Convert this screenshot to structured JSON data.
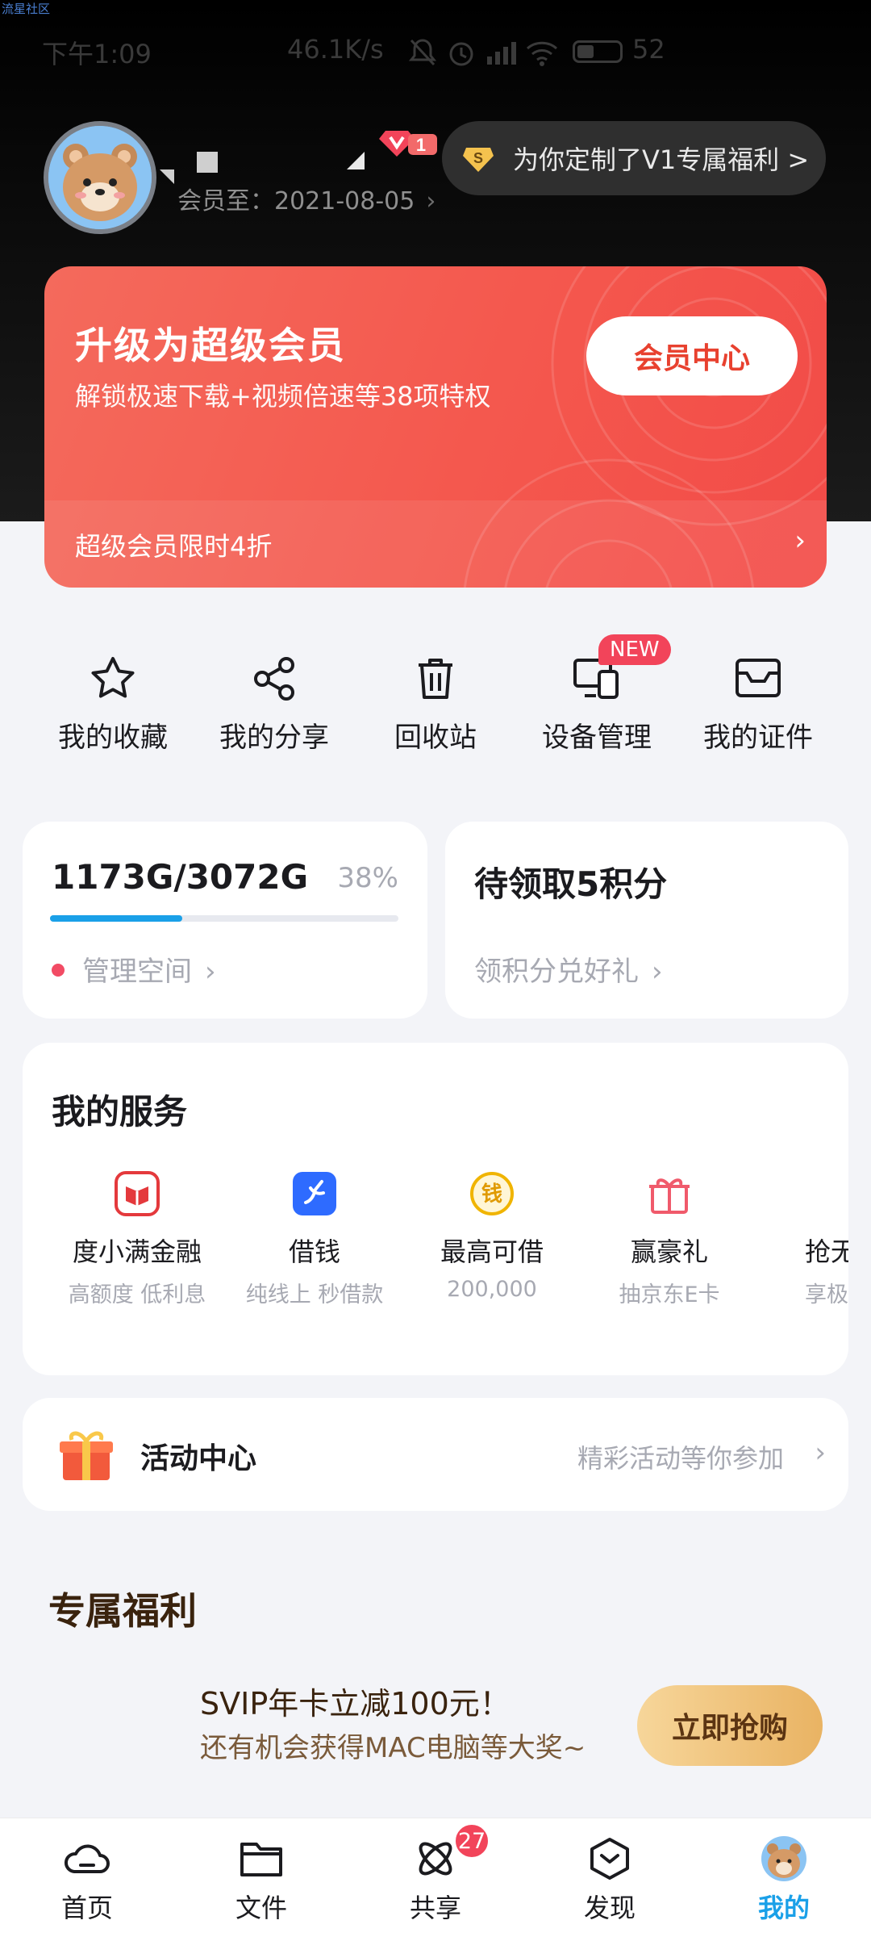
{
  "watermark": "流星社区",
  "status": {
    "time": "下午1:09",
    "net_speed": "46.1K/s",
    "battery": "52"
  },
  "profile": {
    "member_until": "会员至：2021-08-05",
    "vip_level": "1"
  },
  "promo": {
    "label": "为你定制了V1专属福利 >"
  },
  "vip_card": {
    "title": "升级为超级会员",
    "subtitle": "解锁极速下载+视频倍速等38项特权",
    "button": "会员中心",
    "bar_text": "超级会员限时4折"
  },
  "quick_actions": [
    {
      "label": "我的收藏",
      "icon": "star-icon"
    },
    {
      "label": "我的分享",
      "icon": "share-icon"
    },
    {
      "label": "回收站",
      "icon": "trash-icon"
    },
    {
      "label": "设备管理",
      "icon": "devices-icon"
    },
    {
      "label": "我的证件",
      "icon": "id-card-icon"
    }
  ],
  "new_tag": "NEW",
  "storage": {
    "value": "1173G/3072G",
    "percent": "38%",
    "used_fraction": 0.38,
    "manage": "管理空间"
  },
  "points": {
    "title": "待领取5积分",
    "link": "领积分兑好礼"
  },
  "services": {
    "title": "我的服务",
    "items": [
      {
        "name": "度小满金融",
        "desc": "高额度 低利息"
      },
      {
        "name": "借钱",
        "desc": "纯线上  秒借款"
      },
      {
        "name": "最高可借",
        "desc": "200,000"
      },
      {
        "name": "赢豪礼",
        "desc": "抽京东E卡"
      },
      {
        "name": "抢无限",
        "desc": "享极速"
      }
    ],
    "loan_icon_char": "钱"
  },
  "activity": {
    "title": "活动中心",
    "hint": "精彩活动等你参加"
  },
  "benefits": {
    "title": "专属福利",
    "offer_line1": "SVIP年卡立减100元！",
    "offer_line2": "还有机会获得MAC电脑等大奖~",
    "buy": "立即抢购"
  },
  "tabs": [
    {
      "label": "首页"
    },
    {
      "label": "文件"
    },
    {
      "label": "共享",
      "badge": "27"
    },
    {
      "label": "发现"
    },
    {
      "label": "我的"
    }
  ],
  "colors": {
    "accent": "#1aa0e8",
    "vip_red": "#f4584e",
    "badge": "#f2445a",
    "gold": "#e9b363"
  }
}
